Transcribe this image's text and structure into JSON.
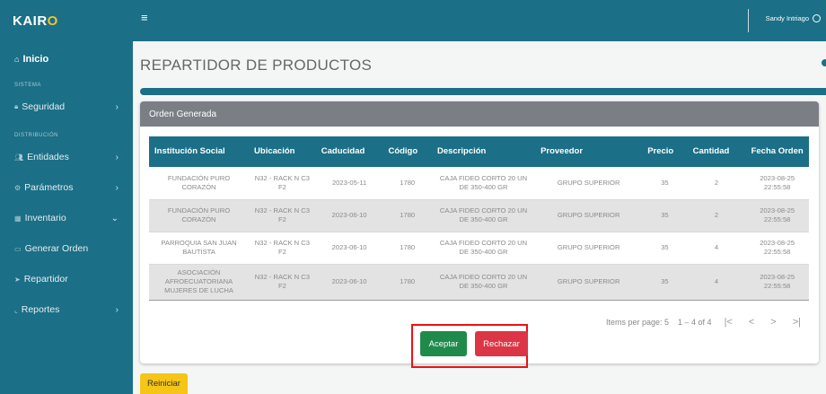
{
  "brand": {
    "prefix": "KAIR",
    "accent": "O"
  },
  "sidebar": {
    "home": "Inicio",
    "section_sistema": "SISTEMA",
    "section_distribucion": "DISTRIBUCIÓN",
    "items": [
      {
        "label": "Seguridad",
        "icon": "lock-icon",
        "chevron": "›"
      },
      {
        "label": "Entidades",
        "icon": "people-icon",
        "chevron": "›"
      },
      {
        "label": "Parámetros",
        "icon": "sliders-icon",
        "chevron": "›"
      },
      {
        "label": "Inventario",
        "icon": "box-icon",
        "chevron": "⌄"
      },
      {
        "label": "Generar Orden",
        "icon": "cart-icon",
        "chevron": ""
      },
      {
        "label": "Repartidor",
        "icon": "send-icon",
        "chevron": ""
      },
      {
        "label": "Reportes",
        "icon": "chart-icon",
        "chevron": "›"
      }
    ]
  },
  "topbar": {
    "menu_icon": "≡",
    "user_name": "Sandy Intriago"
  },
  "page": {
    "title": "REPARTIDOR DE PRODUCTOS"
  },
  "card": {
    "header": "Orden Generada"
  },
  "table": {
    "headers": [
      "Institución Social",
      "Ubicación",
      "Caducidad",
      "Código",
      "Descripción",
      "Proveedor",
      "Precio",
      "Cantidad",
      "Fecha Orden"
    ],
    "rows": [
      [
        "FUNDACIÓN PURO CORAZÓN",
        "N32 - RACK N C3 F2",
        "2023-05-11",
        "1780",
        "CAJA FIDEO CORTO 20 UN DE 350-400 GR",
        "GRUPO SUPERIOR",
        "35",
        "2",
        "2023-08-25 22:55:58"
      ],
      [
        "FUNDACIÓN PURO CORAZÓN",
        "N32 - RACK N C3 F2",
        "2023-06-10",
        "1780",
        "CAJA FIDEO CORTO 20 UN DE 350-400 GR",
        "GRUPO SUPERIOR",
        "35",
        "2",
        "2023-08-25 22:55:58"
      ],
      [
        "PARROQUIA SAN JUAN BAUTISTA",
        "N32 - RACK N C3 F2",
        "2023-06-10",
        "1780",
        "CAJA FIDEO CORTO 20 UN DE 350-400 GR",
        "GRUPO SUPERIOR",
        "35",
        "4",
        "2023-08-25 22:55:58"
      ],
      [
        "ASOCIACIÓN AFROECUATORIANA MUJERES DE LUCHA",
        "N32 - RACK N C3 F2",
        "2023-06-10",
        "1780",
        "CAJA FIDEO CORTO 20 UN DE 350-400 GR",
        "GRUPO SUPERIOR",
        "35",
        "4",
        "2023-08-25 22:55:58"
      ]
    ]
  },
  "paginator": {
    "items_label": "Items per page:",
    "page_size": "5",
    "range": "1 – 4 of 4",
    "first": "|<",
    "prev": "<",
    "next": ">",
    "last": ">|"
  },
  "actions": {
    "accept": "Aceptar",
    "reject": "Rechazar",
    "reset": "Reiniciar"
  },
  "colors": {
    "primary": "#1b6f86",
    "accent": "#f2c230",
    "accept": "#1f8a4a",
    "reject": "#dc3545",
    "reset": "#f5c518"
  }
}
